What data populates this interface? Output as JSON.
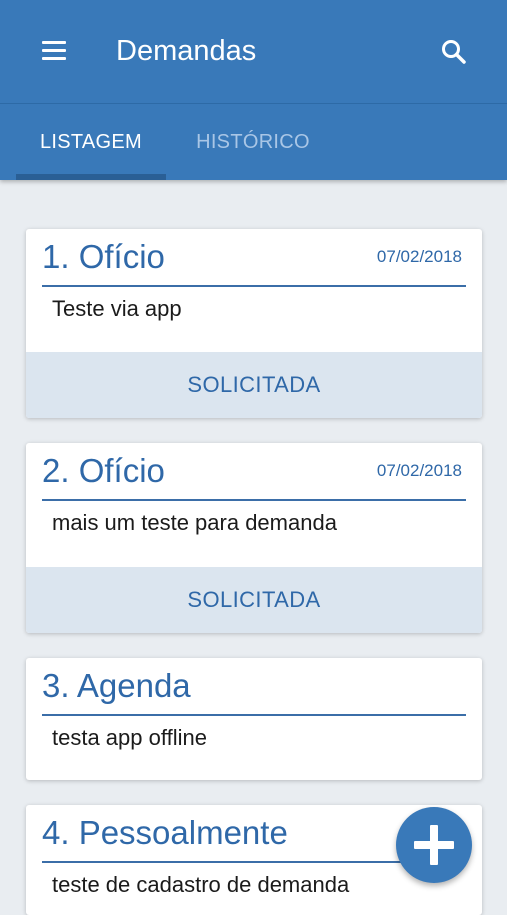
{
  "app_bar": {
    "title": "Demandas",
    "menu_icon": "menu-icon",
    "search_icon": "search-icon",
    "background": "#3979b9"
  },
  "tabs": [
    {
      "label": "LISTAGEM",
      "active": true
    },
    {
      "label": "HISTÓRICO",
      "active": false
    }
  ],
  "demands": [
    {
      "title": "1. Ofício",
      "date": "07/02/2018",
      "description": "Teste via app",
      "status": "SOLICITADA"
    },
    {
      "title": "2. Ofício",
      "date": "07/02/2018",
      "description": "mais um teste para demanda",
      "status": "SOLICITADA"
    },
    {
      "title": "3. Agenda",
      "date": "",
      "description": "testa app offline",
      "status": ""
    },
    {
      "title": "4. Pessoalmente",
      "date": "",
      "description": "teste de cadastro de demanda",
      "status": ""
    }
  ],
  "fab": {
    "icon": "plus-icon"
  },
  "colors": {
    "accent": "#3979b9",
    "card_title": "#2f68a8",
    "status_bg": "#dbe5ef",
    "page_bg": "#e9edf1"
  }
}
